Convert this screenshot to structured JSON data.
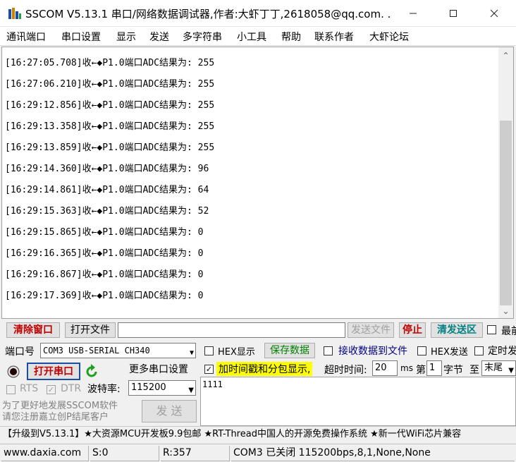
{
  "window": {
    "title": "SSCOM V5.13.1 串口/网络数据调试器,作者:大虾丁丁,2618058@qq.com. ..."
  },
  "menu": [
    "通讯端口",
    "串口设置",
    "显示",
    "发送",
    "多字符串",
    "小工具",
    "帮助",
    "联系作者",
    "大虾论坛"
  ],
  "log": {
    "lines": [
      "[16:27:05.708]收←◆P1.0端口ADC结果为: 255",
      "[16:27:06.210]收←◆P1.0端口ADC结果为: 255",
      "[16:29:12.856]收←◆P1.0端口ADC结果为: 255",
      "[16:29:13.358]收←◆P1.0端口ADC结果为: 255",
      "[16:29:13.859]收←◆P1.0端口ADC结果为: 255",
      "[16:29:14.360]收←◆P1.0端口ADC结果为: 96",
      "[16:29:14.861]收←◆P1.0端口ADC结果为: 64",
      "[16:29:15.363]收←◆P1.0端口ADC结果为: 52",
      "[16:29:15.865]收←◆P1.0端口ADC结果为: 0",
      "[16:29:16.365]收←◆P1.0端口ADC结果为: 0",
      "[16:29:16.867]收←◆P1.0端口ADC结果为: 0",
      "[16:29:17.369]收←◆P1.0端口ADC结果为: 0"
    ]
  },
  "toolbar": {
    "clear_window": "清除窗口",
    "open_file": "打开文件",
    "file_path": "",
    "send_file": "发送文件",
    "stop": "停止",
    "clear_send_area": "清发送区",
    "last_label": "最前"
  },
  "port": {
    "label": "端口号",
    "value": "COM3 USB-SERIAL CH340",
    "open_button": "打开串口",
    "more_settings": "更多串口设置",
    "rts": "RTS",
    "dtr": "DTR",
    "baud_label": "波特率:",
    "baud_value": "115200"
  },
  "options": {
    "hex_display": "HEX显示",
    "save_data": "保存数据",
    "recv_to_file": "接收数据到文件",
    "hex_send": "HEX发送",
    "timed_send": "定时发",
    "timestamp": "加时间戳和分包显示,",
    "timeout_label": "超时时间:",
    "timeout_value": "20",
    "timeout_unit": "ms",
    "byte_prefix": "第",
    "byte_value": "1",
    "byte_suffix": "字节",
    "to_label": "至",
    "to_value": "末尾"
  },
  "promo": {
    "text": "为了更好地发展SSCOM软件\n请您注册嘉立创P结尾客户",
    "send_button": "发 送"
  },
  "send_area": {
    "text": "1111"
  },
  "marquee": "【升级到V5.13.1】★大资源MCU开发板9.9包邮 ★RT-Thread中国人的开源免费操作系统 ★新一代WiFi芯片兼容",
  "status": {
    "website": "www.daxia.com",
    "sent": "S:0",
    "received": "R:357",
    "port_state": "COM3 已关闭  115200bps,8,1,None,None"
  },
  "colors": {
    "accent_red": "#c00000",
    "highlight": "#ffff00",
    "teal": "#008080"
  }
}
